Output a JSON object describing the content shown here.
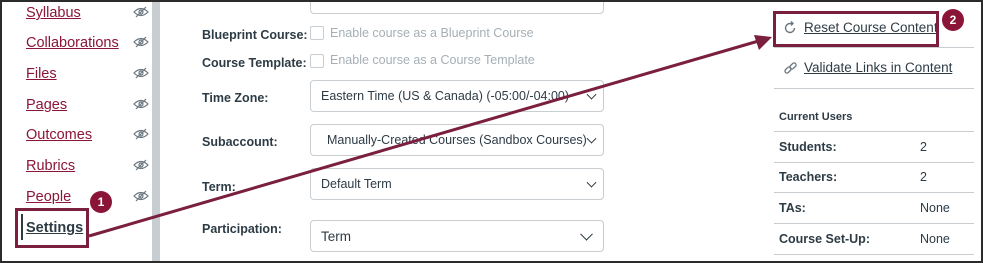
{
  "nav": {
    "items": [
      {
        "label": "Syllabus"
      },
      {
        "label": "Collaborations"
      },
      {
        "label": "Files"
      },
      {
        "label": "Pages"
      },
      {
        "label": "Outcomes"
      },
      {
        "label": "Rubrics"
      },
      {
        "label": "People"
      }
    ],
    "active": {
      "label": "Settings"
    },
    "eye_icon": "eye-hidden-icon"
  },
  "form": {
    "blueprint": {
      "label": "Blueprint Course:",
      "checkbox_label": "Enable course as a Blueprint Course",
      "checked": false
    },
    "template": {
      "label": "Course Template:",
      "checkbox_label": "Enable course as a Course Template",
      "checked": false
    },
    "timezone": {
      "label": "Time Zone:",
      "value": "Eastern Time (US & Canada) (-05:00/-04:00)"
    },
    "subaccount": {
      "label": "Subaccount:",
      "value": "Manually-Created Courses (Sandbox Courses)"
    },
    "term": {
      "label": "Term:",
      "value": "Default Term"
    },
    "participation": {
      "label": "Participation:",
      "value": "Term"
    }
  },
  "sidebar": {
    "reset_link": "Reset Course Content",
    "validate_link": "Validate Links in Content",
    "current_users_heading": "Current Users",
    "rows": [
      {
        "label": "Students:",
        "value": "2"
      },
      {
        "label": "Teachers:",
        "value": "2"
      },
      {
        "label": "TAs:",
        "value": "None"
      },
      {
        "label": "Course Set-Up:",
        "value": "None"
      }
    ]
  },
  "annotations": {
    "badge1": "1",
    "badge2": "2",
    "accent_color": "#8a1538"
  }
}
